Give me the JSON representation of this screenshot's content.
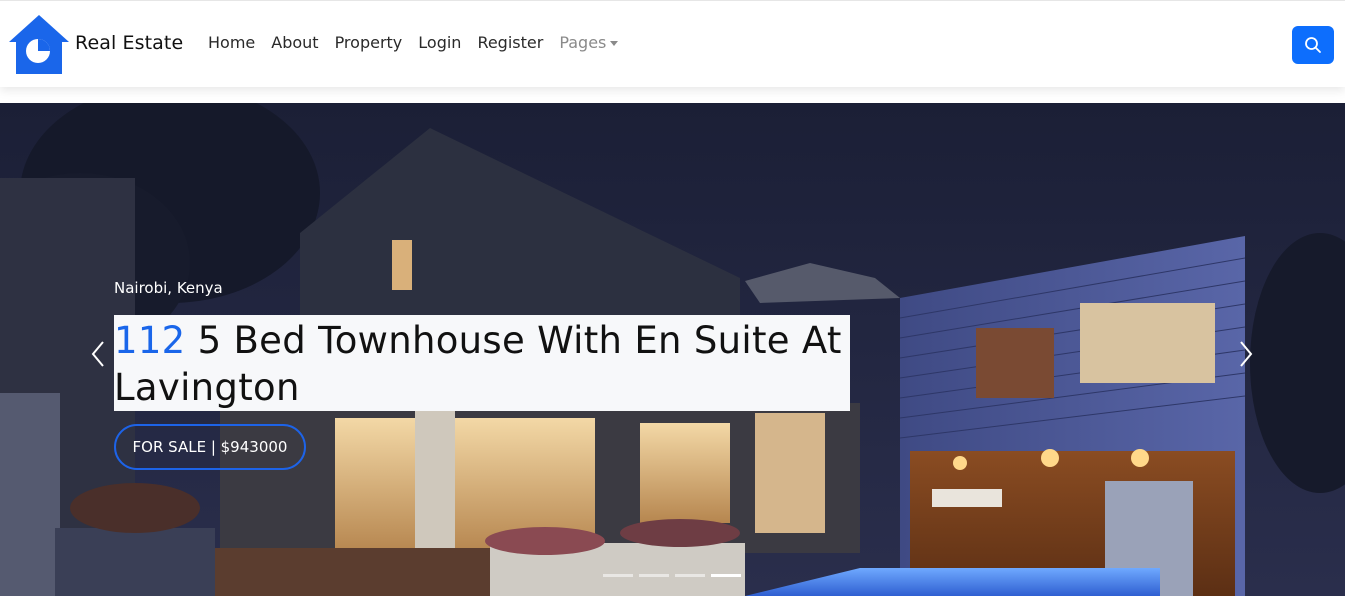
{
  "brand": {
    "name": "Real Estate",
    "logo_icon": "house-pie-logo",
    "color": "#1a66ea"
  },
  "nav": {
    "items": [
      {
        "label": "Home"
      },
      {
        "label": "About"
      },
      {
        "label": "Property"
      },
      {
        "label": "Login"
      },
      {
        "label": "Register"
      }
    ],
    "dropdown": {
      "label": "Pages",
      "icon": "caret-down-icon"
    }
  },
  "search": {
    "icon": "search-icon",
    "color": "#0d6efd"
  },
  "hero": {
    "location": "Nairobi, Kenya",
    "title_number": "112",
    "title_text": "5 Bed Townhouse With En Suite At Lavington",
    "status": "FOR SALE | $943000",
    "accent_color": "#1a66ea",
    "slides_total": 4,
    "active_slide": 4
  }
}
